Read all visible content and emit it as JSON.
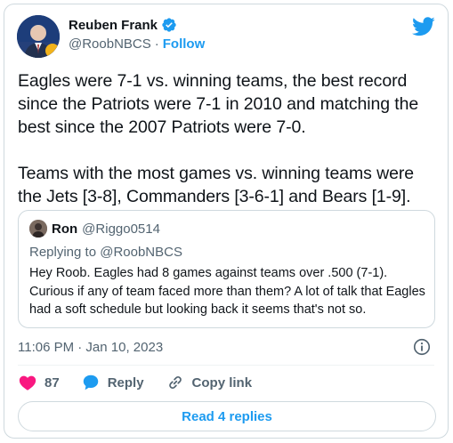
{
  "author": {
    "name": "Reuben Frank",
    "handle": "@RoobNBCS",
    "separator": "·",
    "follow_label": "Follow",
    "avatar_icon": "profile-photo",
    "verified_icon": "verified-badge-icon"
  },
  "tweet": {
    "text": "Eagles were 7-1 vs. winning teams, the best record since the Patriots were 7-1 in 2010 and matching the best since the 2007 Patriots were 7-0.\n\nTeams with the most games vs. winning teams were the Jets [3-8], Commanders [3-6-1] and Bears [1-9].",
    "timestamp": "11:06 PM · Jan 10, 2023"
  },
  "quoted": {
    "name": "Ron",
    "handle": "@Riggo0514",
    "replying_to": "Replying to @RoobNBCS",
    "text": "Hey Roob. Eagles had 8 games against teams over .500 (7-1). Curious if any of team faced more than them? A lot of talk that Eagles had a soft schedule but looking back it seems that's not so."
  },
  "actions": {
    "like_count": "87",
    "reply_label": "Reply",
    "copy_label": "Copy link",
    "read_replies_label": "Read 4 replies"
  },
  "colors": {
    "accent": "#1d9bf0",
    "like": "#f91880",
    "text": "#0f1419",
    "muted": "#536471",
    "border": "#cfd9de"
  }
}
